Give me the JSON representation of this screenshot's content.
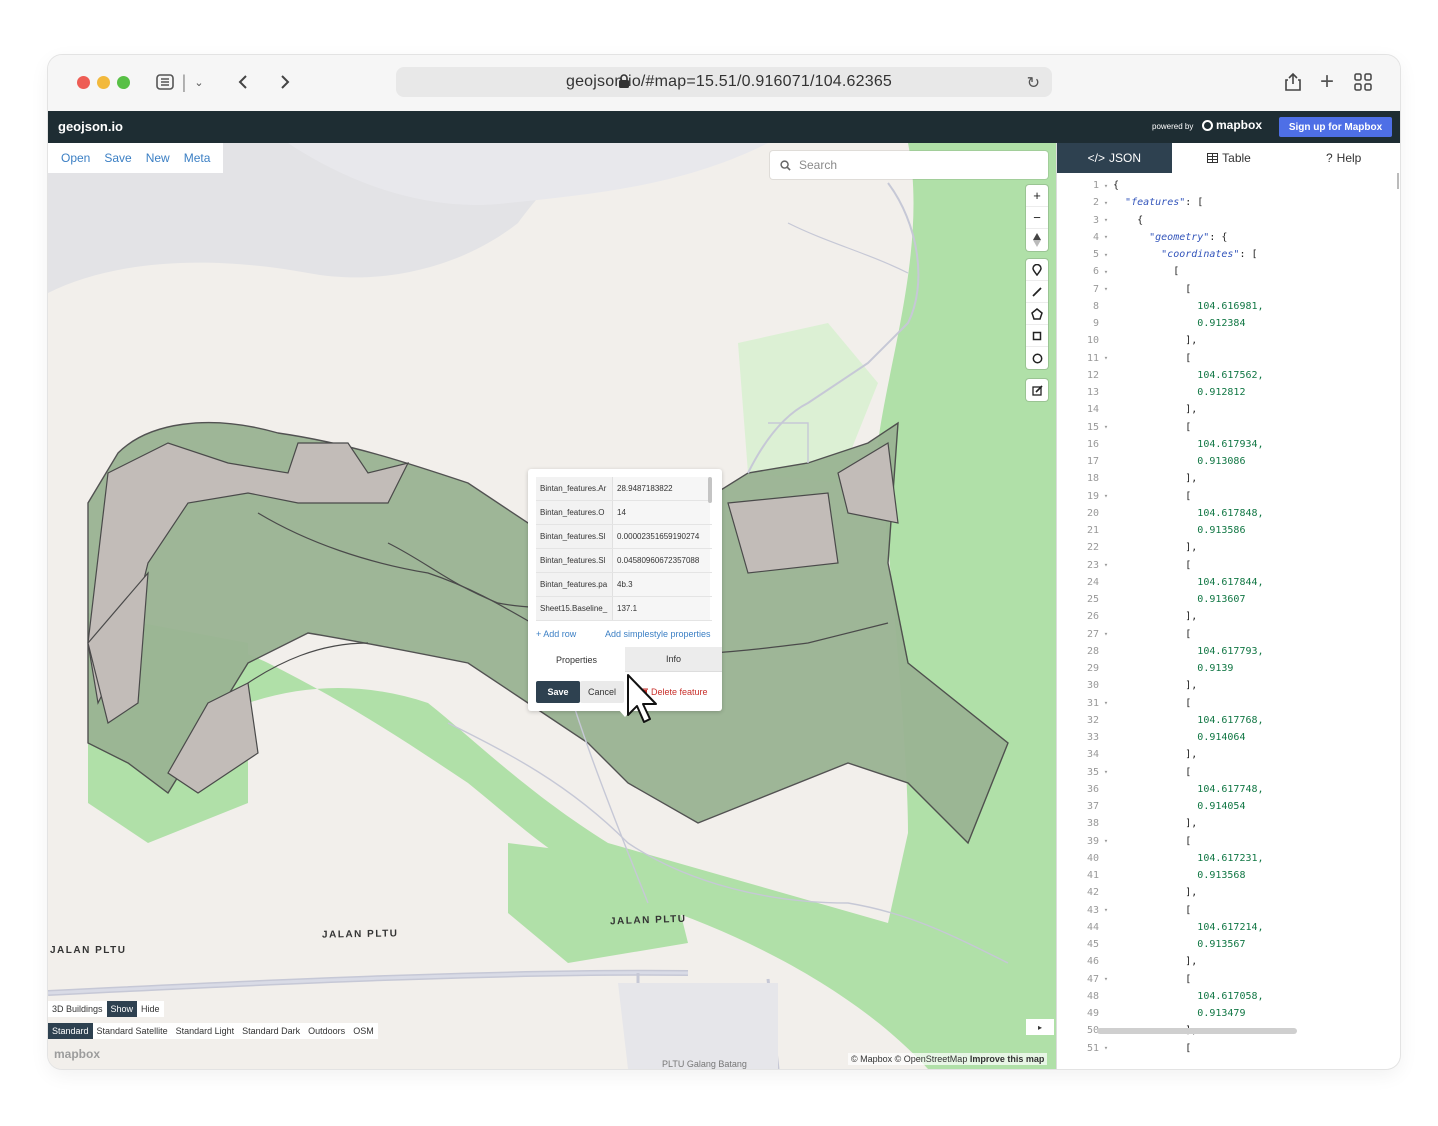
{
  "browser": {
    "url": "geojson.io/#map=15.51/0.916071/104.62365"
  },
  "app": {
    "brand": "geojson.io",
    "powered_by": "powered by",
    "mapbox_logo": "mapbox",
    "signup_label": "Sign up for Mapbox"
  },
  "filemenu": [
    "Open",
    "Save",
    "New",
    "Meta"
  ],
  "search": {
    "placeholder": "Search"
  },
  "popup": {
    "rows": [
      {
        "key": "Bintan_features.Ar",
        "value": "28.9487183822"
      },
      {
        "key": "Bintan_features.O",
        "value": "14"
      },
      {
        "key": "Bintan_features.Sl",
        "value": "0.00002351659190274"
      },
      {
        "key": "Bintan_features.Sl",
        "value": "0.04580960672357088"
      },
      {
        "key": "Bintan_features.pa",
        "value": "4b.3"
      },
      {
        "key": "Sheet15.Baseline_",
        "value": "137.1"
      }
    ],
    "add_row": "+ Add row",
    "add_simplestyle": "Add simplestyle properties",
    "tab_properties": "Properties",
    "tab_info": "Info",
    "save": "Save",
    "cancel": "Cancel",
    "delete": "Delete feature"
  },
  "map": {
    "road_labels": [
      "JALAN PLTU",
      "JALAN PLTU",
      "JALAN PLTU"
    ],
    "place_label": "PLTU Galang Batang",
    "buildings_label": "3D Buildings",
    "buildings_show": "Show",
    "buildings_hide": "Hide",
    "styles": [
      "Standard",
      "Standard Satellite",
      "Standard Light",
      "Standard Dark",
      "Outdoors",
      "OSM"
    ],
    "selected_style": "Standard",
    "watermark": "mapbox",
    "attribution": "© Mapbox © OpenStreetMap",
    "improve": "Improve this map",
    "colors": {
      "land": "#f2efeb",
      "green": "#b0e0a8",
      "feature": "#9ab493",
      "feature_outline": "#4a4a4a",
      "water": "#e3e3e6"
    }
  },
  "panel": {
    "tabs": [
      {
        "icon": "code-icon",
        "label": "JSON"
      },
      {
        "icon": "table-icon",
        "label": "Table"
      },
      {
        "icon": "help-icon",
        "label": "Help"
      }
    ],
    "lines": [
      {
        "n": "1",
        "fold": true,
        "text": "{"
      },
      {
        "n": "2",
        "fold": true,
        "text": "  \"features\": ["
      },
      {
        "n": "3",
        "fold": true,
        "text": "    {"
      },
      {
        "n": "4",
        "fold": true,
        "text": "      \"geometry\": {"
      },
      {
        "n": "5",
        "fold": true,
        "text": "        \"coordinates\": ["
      },
      {
        "n": "6",
        "fold": true,
        "text": "          ["
      },
      {
        "n": "7",
        "fold": true,
        "text": "            ["
      },
      {
        "n": "8",
        "fold": false,
        "text": "              104.616981,"
      },
      {
        "n": "9",
        "fold": false,
        "text": "              0.912384"
      },
      {
        "n": "10",
        "fold": false,
        "text": "            ],"
      },
      {
        "n": "11",
        "fold": true,
        "text": "            ["
      },
      {
        "n": "12",
        "fold": false,
        "text": "              104.617562,"
      },
      {
        "n": "13",
        "fold": false,
        "text": "              0.912812"
      },
      {
        "n": "14",
        "fold": false,
        "text": "            ],"
      },
      {
        "n": "15",
        "fold": true,
        "text": "            ["
      },
      {
        "n": "16",
        "fold": false,
        "text": "              104.617934,"
      },
      {
        "n": "17",
        "fold": false,
        "text": "              0.913086"
      },
      {
        "n": "18",
        "fold": false,
        "text": "            ],"
      },
      {
        "n": "19",
        "fold": true,
        "text": "            ["
      },
      {
        "n": "20",
        "fold": false,
        "text": "              104.617848,"
      },
      {
        "n": "21",
        "fold": false,
        "text": "              0.913586"
      },
      {
        "n": "22",
        "fold": false,
        "text": "            ],"
      },
      {
        "n": "23",
        "fold": true,
        "text": "            ["
      },
      {
        "n": "24",
        "fold": false,
        "text": "              104.617844,"
      },
      {
        "n": "25",
        "fold": false,
        "text": "              0.913607"
      },
      {
        "n": "26",
        "fold": false,
        "text": "            ],"
      },
      {
        "n": "27",
        "fold": true,
        "text": "            ["
      },
      {
        "n": "28",
        "fold": false,
        "text": "              104.617793,"
      },
      {
        "n": "29",
        "fold": false,
        "text": "              0.9139"
      },
      {
        "n": "30",
        "fold": false,
        "text": "            ],"
      },
      {
        "n": "31",
        "fold": true,
        "text": "            ["
      },
      {
        "n": "32",
        "fold": false,
        "text": "              104.617768,"
      },
      {
        "n": "33",
        "fold": false,
        "text": "              0.914064"
      },
      {
        "n": "34",
        "fold": false,
        "text": "            ],"
      },
      {
        "n": "35",
        "fold": true,
        "text": "            ["
      },
      {
        "n": "36",
        "fold": false,
        "text": "              104.617748,"
      },
      {
        "n": "37",
        "fold": false,
        "text": "              0.914054"
      },
      {
        "n": "38",
        "fold": false,
        "text": "            ],"
      },
      {
        "n": "39",
        "fold": true,
        "text": "            ["
      },
      {
        "n": "40",
        "fold": false,
        "text": "              104.617231,"
      },
      {
        "n": "41",
        "fold": false,
        "text": "              0.913568"
      },
      {
        "n": "42",
        "fold": false,
        "text": "            ],"
      },
      {
        "n": "43",
        "fold": true,
        "text": "            ["
      },
      {
        "n": "44",
        "fold": false,
        "text": "              104.617214,"
      },
      {
        "n": "45",
        "fold": false,
        "text": "              0.913567"
      },
      {
        "n": "46",
        "fold": false,
        "text": "            ],"
      },
      {
        "n": "47",
        "fold": true,
        "text": "            ["
      },
      {
        "n": "48",
        "fold": false,
        "text": "              104.617058,"
      },
      {
        "n": "49",
        "fold": false,
        "text": "              0.913479"
      },
      {
        "n": "50",
        "fold": false,
        "text": "            ],"
      },
      {
        "n": "51",
        "fold": true,
        "text": "            ["
      }
    ]
  }
}
